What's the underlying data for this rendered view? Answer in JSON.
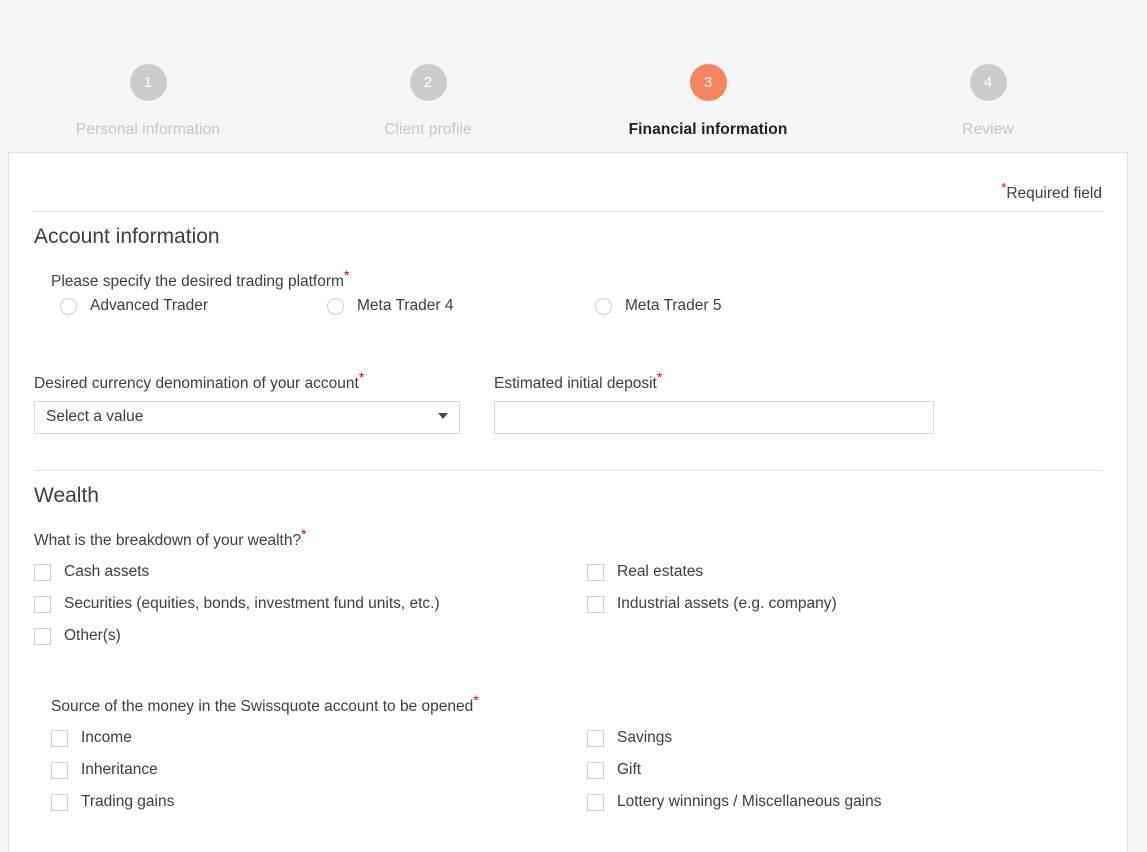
{
  "stepper": {
    "steps": [
      {
        "number": "1",
        "label": "Personal information",
        "state": "inactive"
      },
      {
        "number": "2",
        "label": "Client profile",
        "state": "inactive"
      },
      {
        "number": "3",
        "label": "Financial information",
        "state": "active"
      },
      {
        "number": "4",
        "label": "Review",
        "state": "inactive"
      }
    ]
  },
  "form": {
    "required_note": "Required field",
    "required_marker": "*",
    "sections": {
      "account": {
        "title": "Account information",
        "platform_question": "Please specify the desired trading platform",
        "platform_options": [
          {
            "label": "Advanced Trader",
            "selected": false
          },
          {
            "label": "Meta Trader 4",
            "selected": false
          },
          {
            "label": "Meta Trader 5",
            "selected": false
          }
        ],
        "currency_label": "Desired currency denomination of your account",
        "currency_value": "Select a value",
        "deposit_label": "Estimated initial deposit",
        "deposit_value": "",
        "deposit_placeholder": ""
      },
      "wealth": {
        "title": "Wealth",
        "breakdown_question": "What is the breakdown of your wealth?",
        "breakdown_left": [
          {
            "label": "Cash assets",
            "checked": false
          },
          {
            "label": "Securities (equities, bonds, investment fund units, etc.)",
            "checked": false
          },
          {
            "label": "Other(s)",
            "checked": false
          }
        ],
        "breakdown_right": [
          {
            "label": "Real estates",
            "checked": false
          },
          {
            "label": "Industrial assets (e.g. company)",
            "checked": false
          }
        ],
        "source_question": "Source of the money in the Swissquote account to be opened",
        "source_left": [
          {
            "label": "Income",
            "checked": false
          },
          {
            "label": "Inheritance",
            "checked": false
          },
          {
            "label": "Trading gains",
            "checked": false
          }
        ],
        "source_right": [
          {
            "label": "Savings",
            "checked": false
          },
          {
            "label": "Gift",
            "checked": false
          },
          {
            "label": "Lottery winnings / Miscellaneous gains",
            "checked": false
          }
        ]
      }
    }
  },
  "colors": {
    "accent": "#f6845f",
    "required": "#d0021b",
    "inactive_step": "#cccccc",
    "page_bg": "#f6f6f6",
    "text": "#3c4043"
  }
}
